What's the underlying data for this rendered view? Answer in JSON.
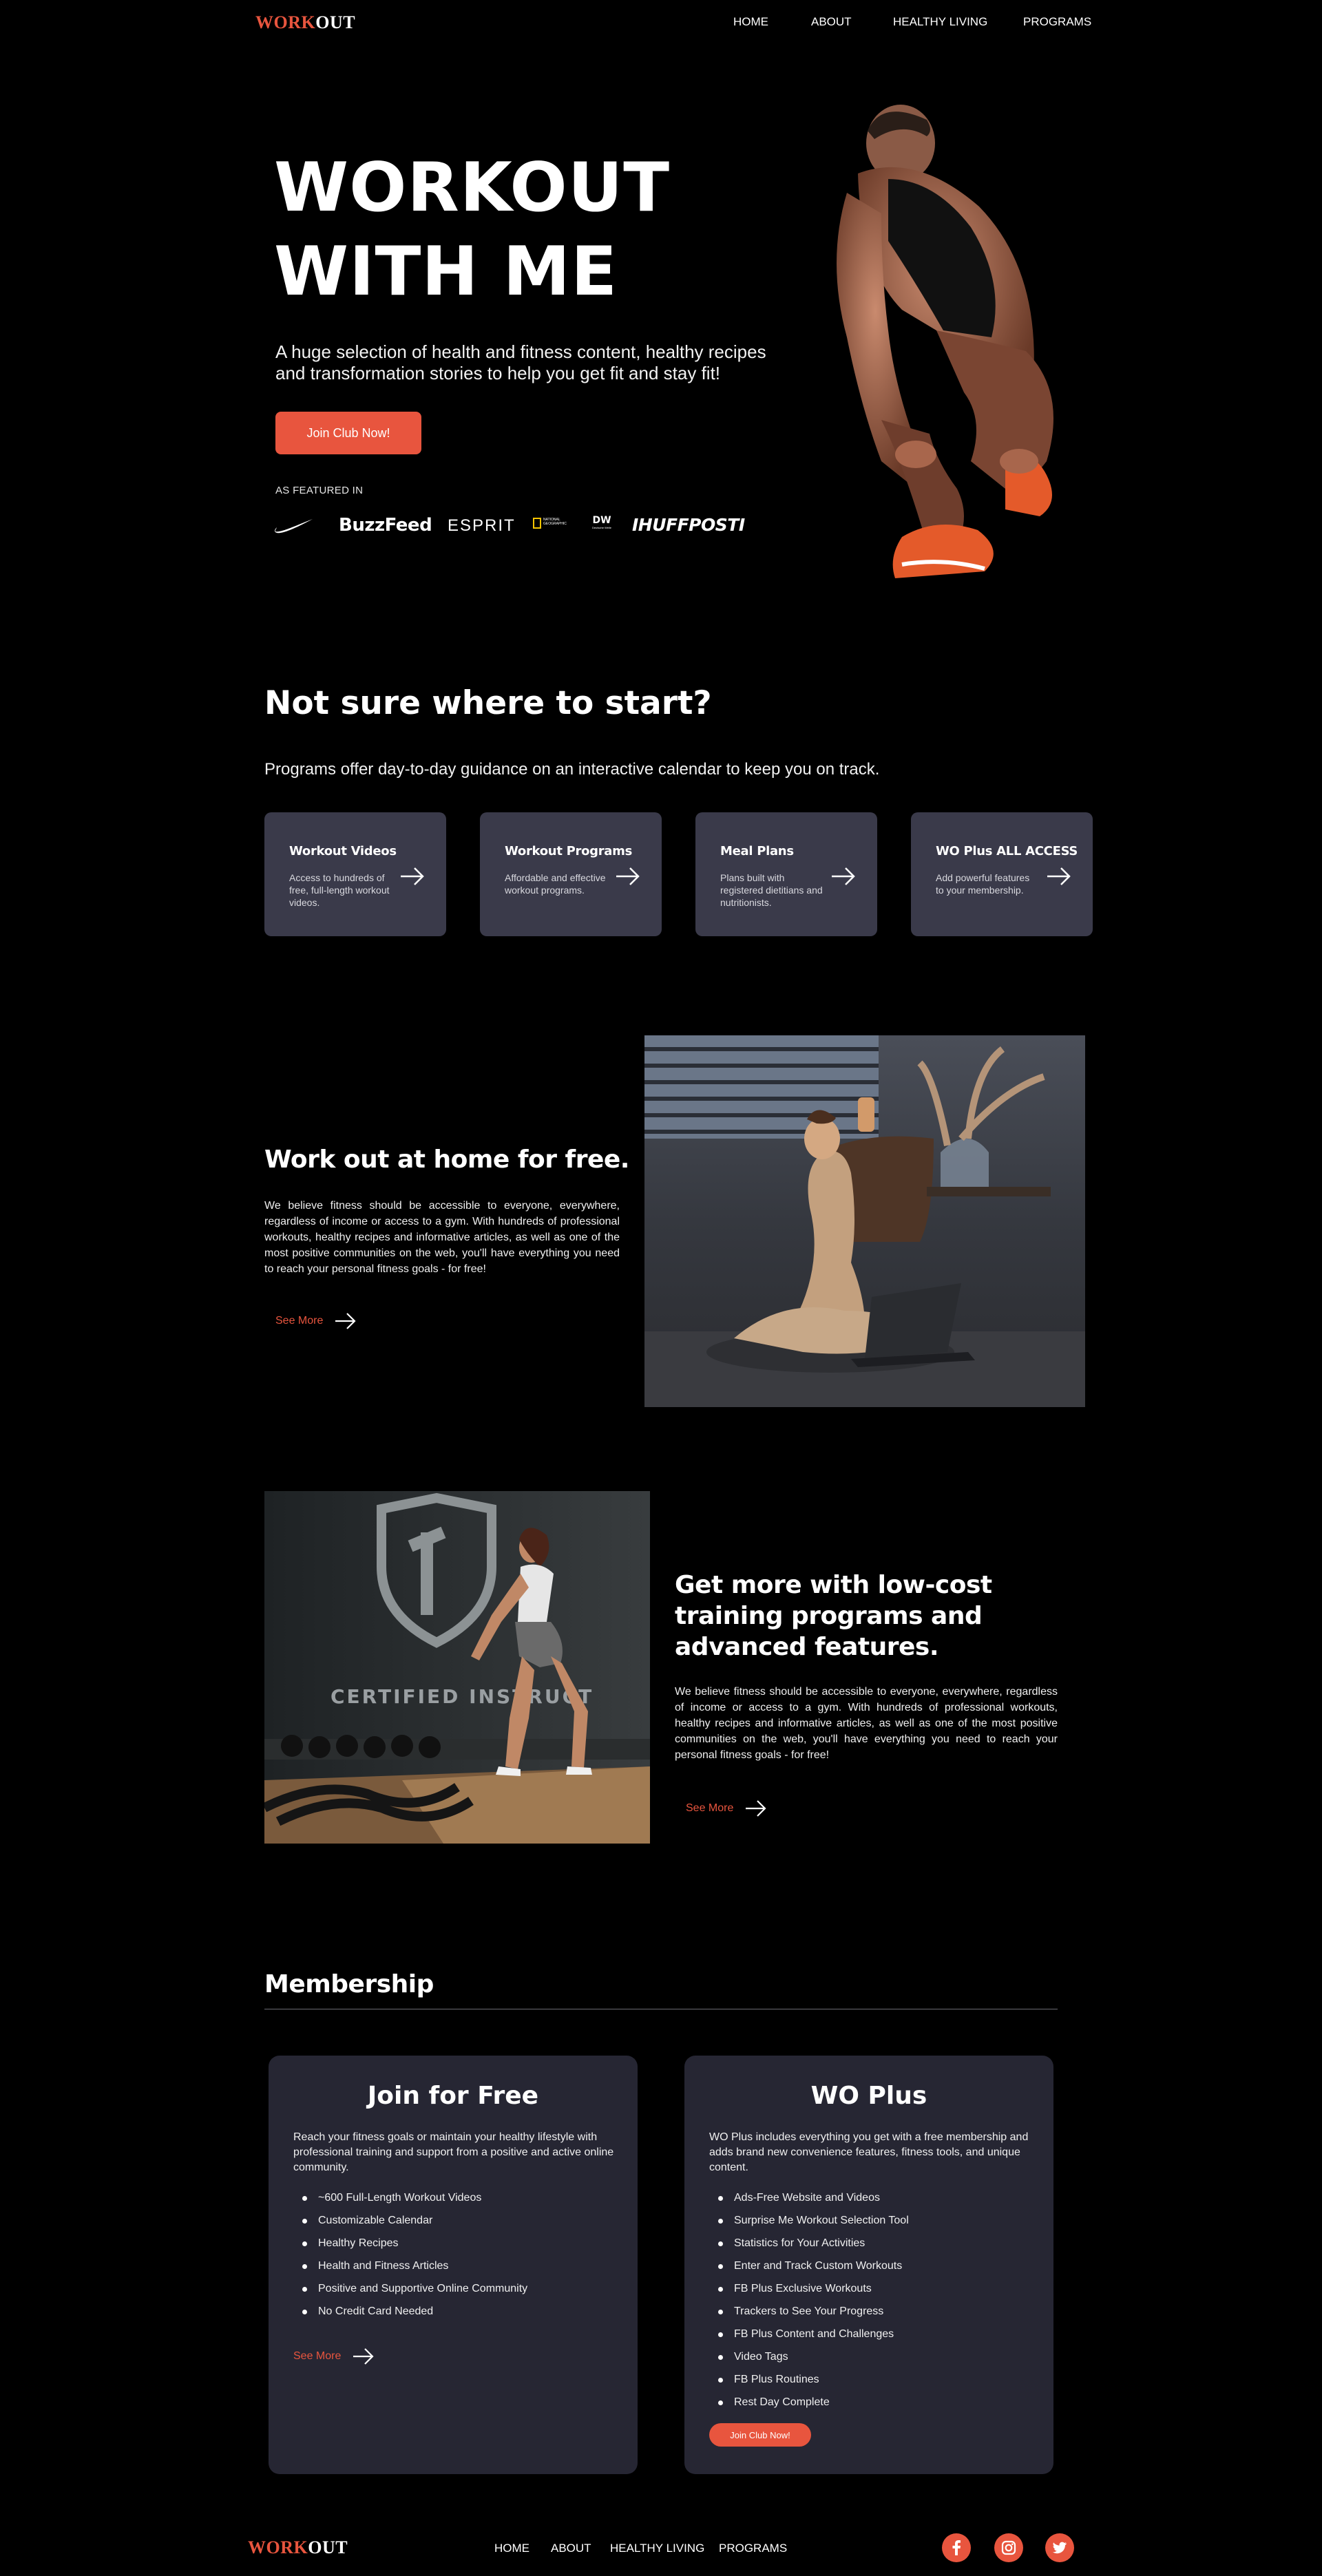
{
  "header": {
    "logo": {
      "part1": "WORK",
      "part2": "OUT"
    },
    "nav": [
      "HOME",
      "ABOUT",
      "HEALTHY LIVING",
      "PROGRAMS"
    ]
  },
  "hero": {
    "title_line1": "WORKOUT",
    "title_line2": "WITH ME",
    "subtitle": "A huge selection of health and fitness content, healthy recipes and transformation stories to help you get fit and stay fit!",
    "cta": "Join Club Now!",
    "featured_label": "AS FEATURED IN",
    "brands": [
      "BuzzFeed",
      "ESPRIT",
      "NATIONAL GEOGRAPHIC",
      "DW",
      "IHUFFPOSTI"
    ],
    "dw_sub": "Deutsche Welle"
  },
  "start": {
    "title": "Not sure where to start?",
    "subtitle": "Programs offer day-to-day guidance on an interactive calendar to keep you on track.",
    "cards": [
      {
        "title": "Workout Videos",
        "desc": "Access to hundreds of free, full-length workout videos."
      },
      {
        "title": "Workout Programs",
        "desc": "Affordable and effective workout programs."
      },
      {
        "title": "Meal Plans",
        "desc": "Plans built with registered dietitians and nutritionists."
      },
      {
        "title": "WO Plus ALL ACCESS",
        "desc": "Add powerful features to your membership."
      }
    ]
  },
  "home_section": {
    "title": "Work out at home for free.",
    "body": "We believe fitness should be accessible to everyone, everywhere, regardless of income or access to a gym. With hundreds of professional workouts, healthy recipes and informative articles, as well as one of the most positive communities on the web, you'll have everything you need to reach your personal fitness goals - for free!",
    "link": "See More"
  },
  "programs_section": {
    "title": "Get more with low-cost training programs and advanced features.",
    "body": "We believe fitness should be accessible to everyone, everywhere, regardless of income or access to a gym. With hundreds of professional workouts, healthy recipes and informative articles, as well as one of the most positive communities on the web, you'll have everything you need to reach your personal fitness goals - for free!",
    "link": "See More",
    "wall_text": "CERTIFIED INSTRUCT"
  },
  "membership": {
    "title": "Membership",
    "free": {
      "title": "Join for Free",
      "desc": "Reach your fitness goals or maintain your healthy lifestyle with professional training and support from a positive and active online community.",
      "items": [
        "~600 Full-Length Workout Videos",
        "Customizable Calendar",
        "Healthy Recipes",
        "Health and Fitness Articles",
        "Positive and Supportive Online Community",
        "No Credit Card Needed"
      ],
      "link": "See More"
    },
    "plus": {
      "title": "WO Plus",
      "desc": "WO Plus includes everything you get with a free membership and adds brand new convenience features, fitness tools, and unique content.",
      "items": [
        "Ads-Free Website and Videos",
        "Surprise Me Workout Selection Tool",
        "Statistics for Your Activities",
        "Enter and Track Custom Workouts",
        "FB Plus Exclusive Workouts",
        "Trackers to See Your Progress",
        "FB Plus Content and Challenges",
        "Video Tags",
        "FB Plus Routines",
        "Rest Day Complete"
      ],
      "cta": "Join Club Now!"
    }
  },
  "footer": {
    "logo": {
      "part1": "WORK",
      "part2": "OUT"
    },
    "nav": [
      "HOME",
      "ABOUT",
      "HEALTHY LIVING",
      "PROGRAMS"
    ],
    "social_icons": [
      "facebook-icon",
      "instagram-icon",
      "twitter-icon"
    ]
  },
  "colors": {
    "accent": "#e8553e",
    "card_bg": "#3a3a4a",
    "membership_card_bg": "#262633",
    "background": "#000000"
  }
}
